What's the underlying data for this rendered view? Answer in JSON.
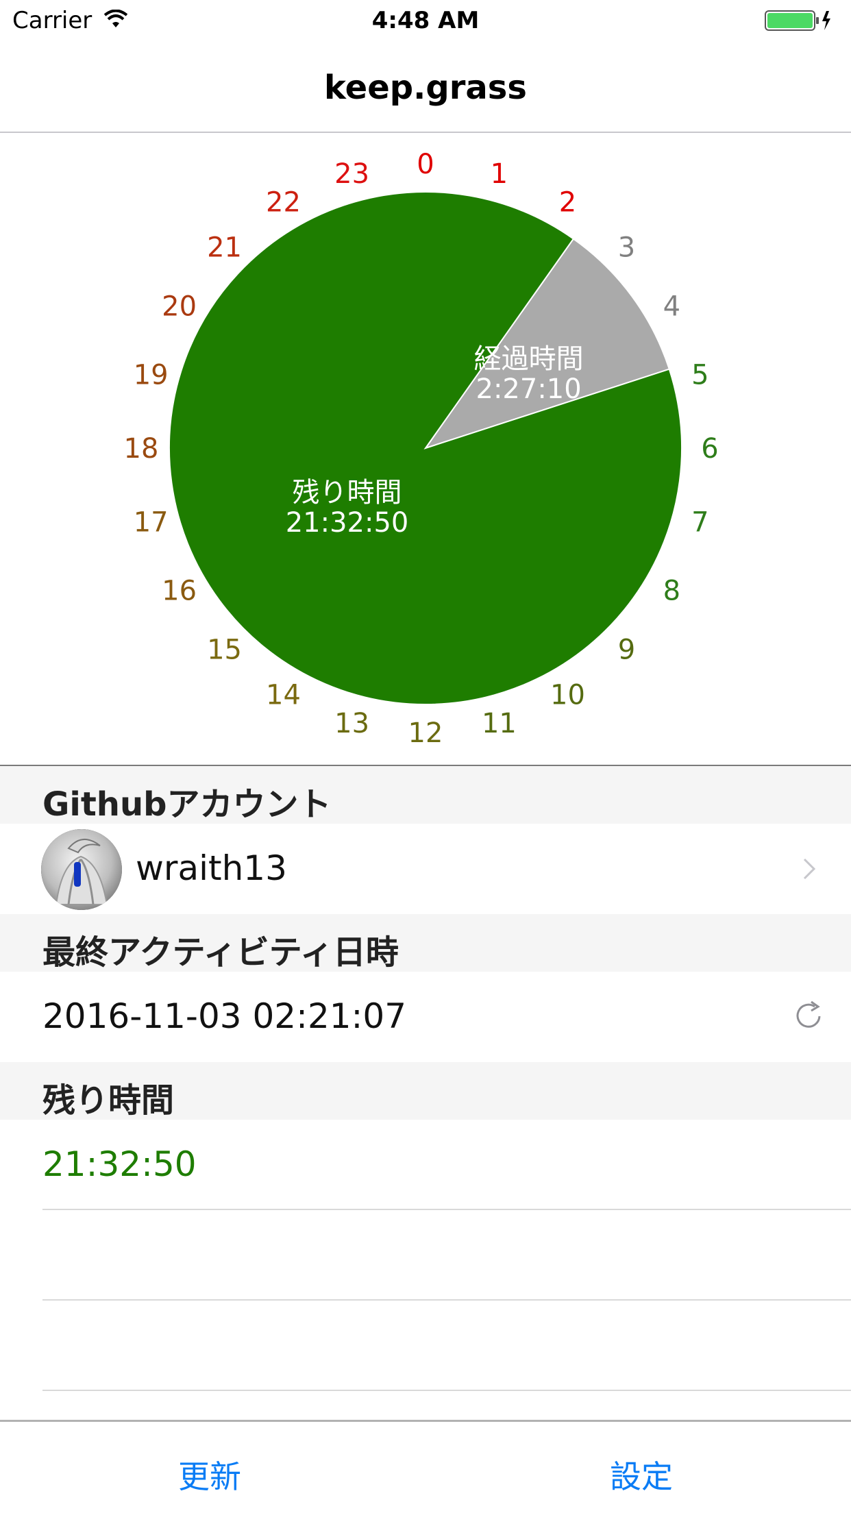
{
  "status_bar": {
    "carrier": "Carrier",
    "time": "4:48 AM",
    "battery_color": "#4cd964"
  },
  "nav": {
    "title": "keep.grass"
  },
  "chart_data": {
    "type": "pie",
    "hour_labels": [
      "0",
      "1",
      "2",
      "3",
      "4",
      "5",
      "6",
      "7",
      "8",
      "9",
      "10",
      "11",
      "12",
      "13",
      "14",
      "15",
      "16",
      "17",
      "18",
      "19",
      "20",
      "21",
      "22",
      "23"
    ],
    "hour_label_colors": [
      "#e00000",
      "#e00000",
      "#e00000",
      "#808080",
      "#808080",
      "#2e7d1a",
      "#2e7d1a",
      "#2e7d1a",
      "#2e7d1a",
      "#556b10",
      "#556b10",
      "#556b10",
      "#6b6b10",
      "#6b6b10",
      "#7a6a10",
      "#7a6a10",
      "#8a5a10",
      "#8a5a10",
      "#9a4a10",
      "#9a4a10",
      "#aa3a10",
      "#bb3010",
      "#cc2010",
      "#dd1010"
    ],
    "slices": [
      {
        "name": "経過時間",
        "value_label": "2:27:10",
        "hours": 2.4528,
        "start_hour": 2.35,
        "color": "#aaaaaa"
      },
      {
        "name": "残り時間",
        "value_label": "21:32:50",
        "hours": 21.5472,
        "start_hour": 4.8028,
        "color": "#1e7d00"
      }
    ]
  },
  "sections": {
    "account": {
      "header": "Githubアカウント",
      "username": "wraith13"
    },
    "last_activity": {
      "header": "最終アクティビティ日時",
      "value": "2016-11-03 02:21:07"
    },
    "remaining": {
      "header": "残り時間",
      "value": "21:32:50",
      "value_color": "#1e7d00"
    }
  },
  "tab_bar": {
    "update_label": "更新",
    "settings_label": "設定",
    "tint": "#0a7cf5"
  }
}
